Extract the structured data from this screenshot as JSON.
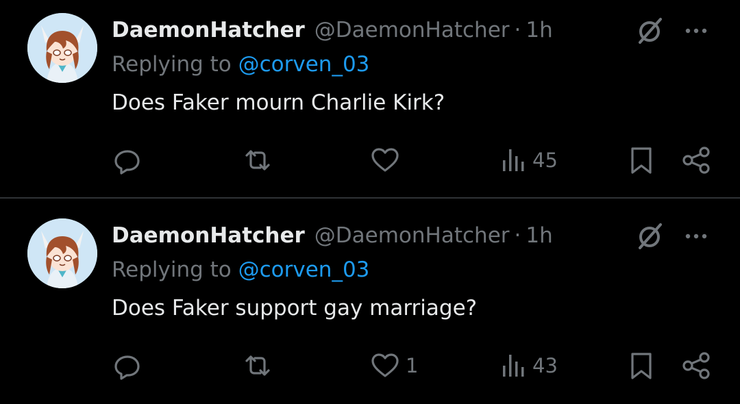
{
  "posts": [
    {
      "display_name": "DaemonHatcher",
      "handle": "@DaemonHatcher",
      "separator": "·",
      "time": "1h",
      "replying_prefix": "Replying to ",
      "replying_to": "@corven_03",
      "text": "Does Faker mourn Charlie Kirk?",
      "reply_count": "",
      "repost_count": "",
      "like_count": "",
      "view_count": "45"
    },
    {
      "display_name": "DaemonHatcher",
      "handle": "@DaemonHatcher",
      "separator": "·",
      "time": "1h",
      "replying_prefix": "Replying to ",
      "replying_to": "@corven_03",
      "text": "Does Faker support gay marriage?",
      "reply_count": "",
      "repost_count": "",
      "like_count": "1",
      "view_count": "43"
    }
  ],
  "icons": {
    "avatar": "anime-avatar",
    "grok": "grok-icon",
    "more": "more-icon",
    "reply": "reply-icon",
    "repost": "repost-icon",
    "like": "heart-icon",
    "views": "views-icon",
    "bookmark": "bookmark-icon",
    "share": "share-icon"
  },
  "colors": {
    "background": "#000000",
    "primary_text": "#e7e9ea",
    "secondary_text": "#71767b",
    "link": "#1d9bf0",
    "divider": "#2f3336"
  }
}
